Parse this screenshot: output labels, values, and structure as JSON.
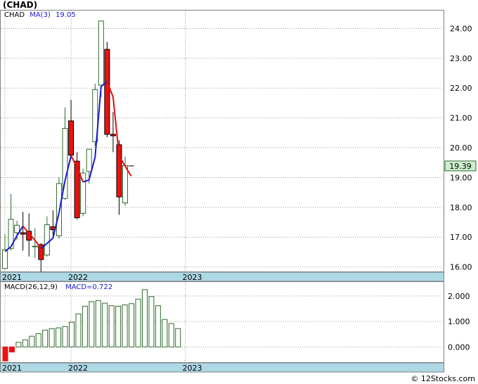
{
  "ticker_title": "(CHAD)",
  "footer": "© 12Stocks.com",
  "colors": {
    "up": "#2e6b2e",
    "down_fill": "#ee1111",
    "ma_up": "#1a1ad0",
    "ma_down": "#e01010",
    "macd": "#2e6b2e",
    "axis_band": "#add8e6",
    "price_box": "#cceecc"
  },
  "chart_data": [
    {
      "type": "candlestick",
      "title": "(CHAD)",
      "legend": {
        "label": "CHAD",
        "ma_label": "MA(3)",
        "ma_value": "19.05"
      },
      "y_ticks": [
        "16.00",
        "17.00",
        "18.00",
        "19.00",
        "20.00",
        "21.00",
        "22.00",
        "23.00",
        "24.00"
      ],
      "ylim": [
        15.85,
        24.6
      ],
      "x_year_labels": [
        {
          "label": "2021",
          "index": 0
        },
        {
          "label": "2022",
          "index": 11
        },
        {
          "label": "2023",
          "index": 30
        }
      ],
      "last_price": "19.39",
      "last_price_value": 19.39,
      "candles": [
        {
          "o": 15.95,
          "h": 17.1,
          "l": 15.92,
          "c": 16.58
        },
        {
          "o": 16.62,
          "h": 18.45,
          "l": 16.55,
          "c": 17.6
        },
        {
          "o": 17.15,
          "h": 17.55,
          "l": 16.9,
          "c": 17.4
        },
        {
          "o": 17.15,
          "h": 17.85,
          "l": 16.55,
          "c": 17.1
        },
        {
          "o": 17.2,
          "h": 17.8,
          "l": 16.35,
          "c": 16.9
        },
        {
          "o": 16.7,
          "h": 17.3,
          "l": 16.3,
          "c": 16.7
        },
        {
          "o": 16.75,
          "h": 16.8,
          "l": 15.75,
          "c": 16.25
        },
        {
          "o": 16.4,
          "h": 17.7,
          "l": 16.35,
          "c": 17.42
        },
        {
          "o": 17.35,
          "h": 17.9,
          "l": 17.05,
          "c": 17.25
        },
        {
          "o": 17.05,
          "h": 19.0,
          "l": 16.95,
          "c": 18.8
        },
        {
          "o": 18.3,
          "h": 21.35,
          "l": 18.25,
          "c": 20.65
        },
        {
          "o": 20.9,
          "h": 21.6,
          "l": 19.65,
          "c": 19.75
        },
        {
          "o": 19.55,
          "h": 19.85,
          "l": 17.6,
          "c": 17.65
        },
        {
          "o": 17.8,
          "h": 19.3,
          "l": 17.7,
          "c": 19.15
        },
        {
          "o": 19.2,
          "h": 19.95,
          "l": 18.8,
          "c": 19.95
        },
        {
          "o": 20.2,
          "h": 22.15,
          "l": 20.05,
          "c": 21.95
        },
        {
          "o": 22.1,
          "h": 24.25,
          "l": 21.7,
          "c": 24.25
        },
        {
          "o": 23.3,
          "h": 23.55,
          "l": 20.35,
          "c": 20.45
        },
        {
          "o": 20.45,
          "h": 21.2,
          "l": 19.85,
          "c": 20.4
        },
        {
          "o": 20.1,
          "h": 20.25,
          "l": 17.75,
          "c": 18.35
        },
        {
          "o": 18.15,
          "h": 19.7,
          "l": 18.05,
          "c": 19.4
        },
        {
          "o": 19.39,
          "h": 19.39,
          "l": 19.39,
          "c": 19.39
        }
      ],
      "ma3": [
        16.52,
        16.68,
        17.05,
        17.37,
        17.13,
        16.9,
        16.62,
        16.79,
        16.97,
        17.82,
        18.9,
        19.73,
        19.35,
        18.85,
        18.92,
        19.68,
        22.05,
        22.22,
        21.7,
        19.73,
        19.38,
        19.05
      ]
    },
    {
      "type": "bar",
      "title": "MACD(26,12,9)",
      "legend": {
        "label": "MACD(26,12,9)",
        "value_label": "MACD=0.722"
      },
      "y_ticks": [
        "0.000",
        "1.000",
        "2.000"
      ],
      "ylim": [
        -0.6,
        2.55
      ],
      "x_year_labels": [
        {
          "label": "2021",
          "index": 0
        },
        {
          "label": "2022",
          "index": 11
        },
        {
          "label": "2023",
          "index": 30
        }
      ],
      "values": [
        -0.55,
        -0.2,
        0.18,
        0.28,
        0.42,
        0.52,
        0.66,
        0.72,
        0.75,
        0.8,
        0.97,
        1.3,
        1.6,
        1.78,
        1.82,
        1.72,
        1.62,
        1.6,
        1.65,
        1.7,
        1.88,
        2.25,
        1.98,
        1.62,
        1.08,
        0.92,
        0.72
      ]
    }
  ]
}
